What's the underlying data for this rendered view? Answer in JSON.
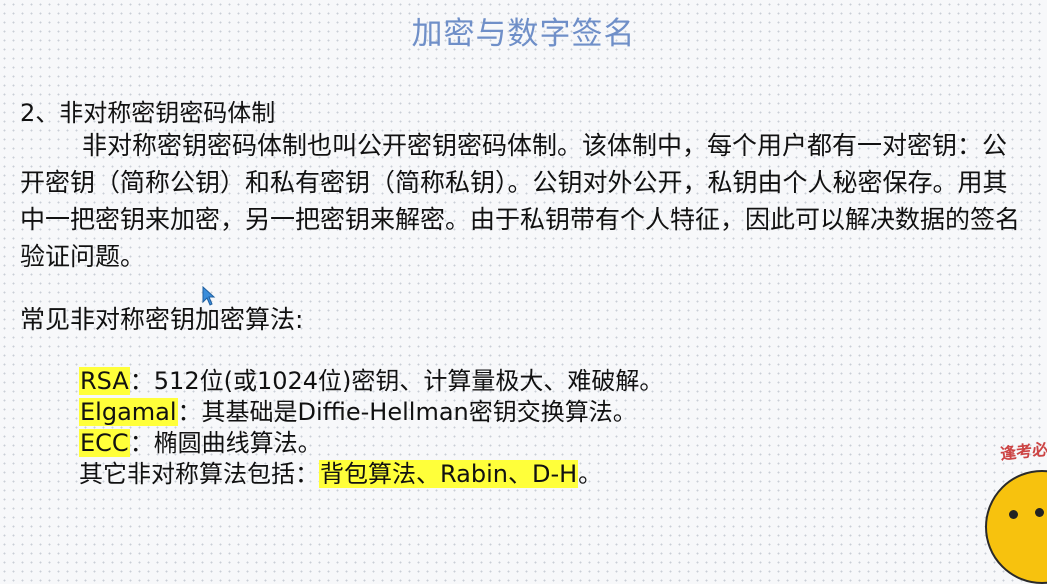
{
  "slide": {
    "title": "加密与数字签名",
    "section_heading": "2、非对称密钥密码体制",
    "paragraph": "非对称密钥密码体制也叫公开密钥密码体制。该体制中，每个用户都有一对密钥：公开密钥（简称公钥）和私有密钥（简称私钥）。公钥对外公开，私钥由个人秘密保存。用其中一把密钥来加密，另一把密钥来解密。由于私钥带有个人特征，因此可以解决数据的签名验证问题。",
    "algorithms_heading": "常见非对称密钥加密算法:",
    "algorithms": [
      {
        "name": "RSA",
        "separator": "：",
        "desc": "512位(或1024位)密钥、计算量极大、难破解。"
      },
      {
        "name": "Elgamal",
        "separator": "：",
        "desc": "其基础是Diffie-Hellman密钥交换算法。"
      },
      {
        "name": "ECC",
        "separator": "：",
        "desc": "椭圆曲线算法。"
      }
    ],
    "others": {
      "prefix": "其它非对称算法包括：",
      "highlight": "背包算法、Rabin、D-H",
      "suffix": "。"
    }
  },
  "overlay": {
    "mascot_text": "逢考必"
  },
  "colors": {
    "title": "#6f8fc8",
    "highlight": "#ffff3a",
    "text": "#111111"
  }
}
